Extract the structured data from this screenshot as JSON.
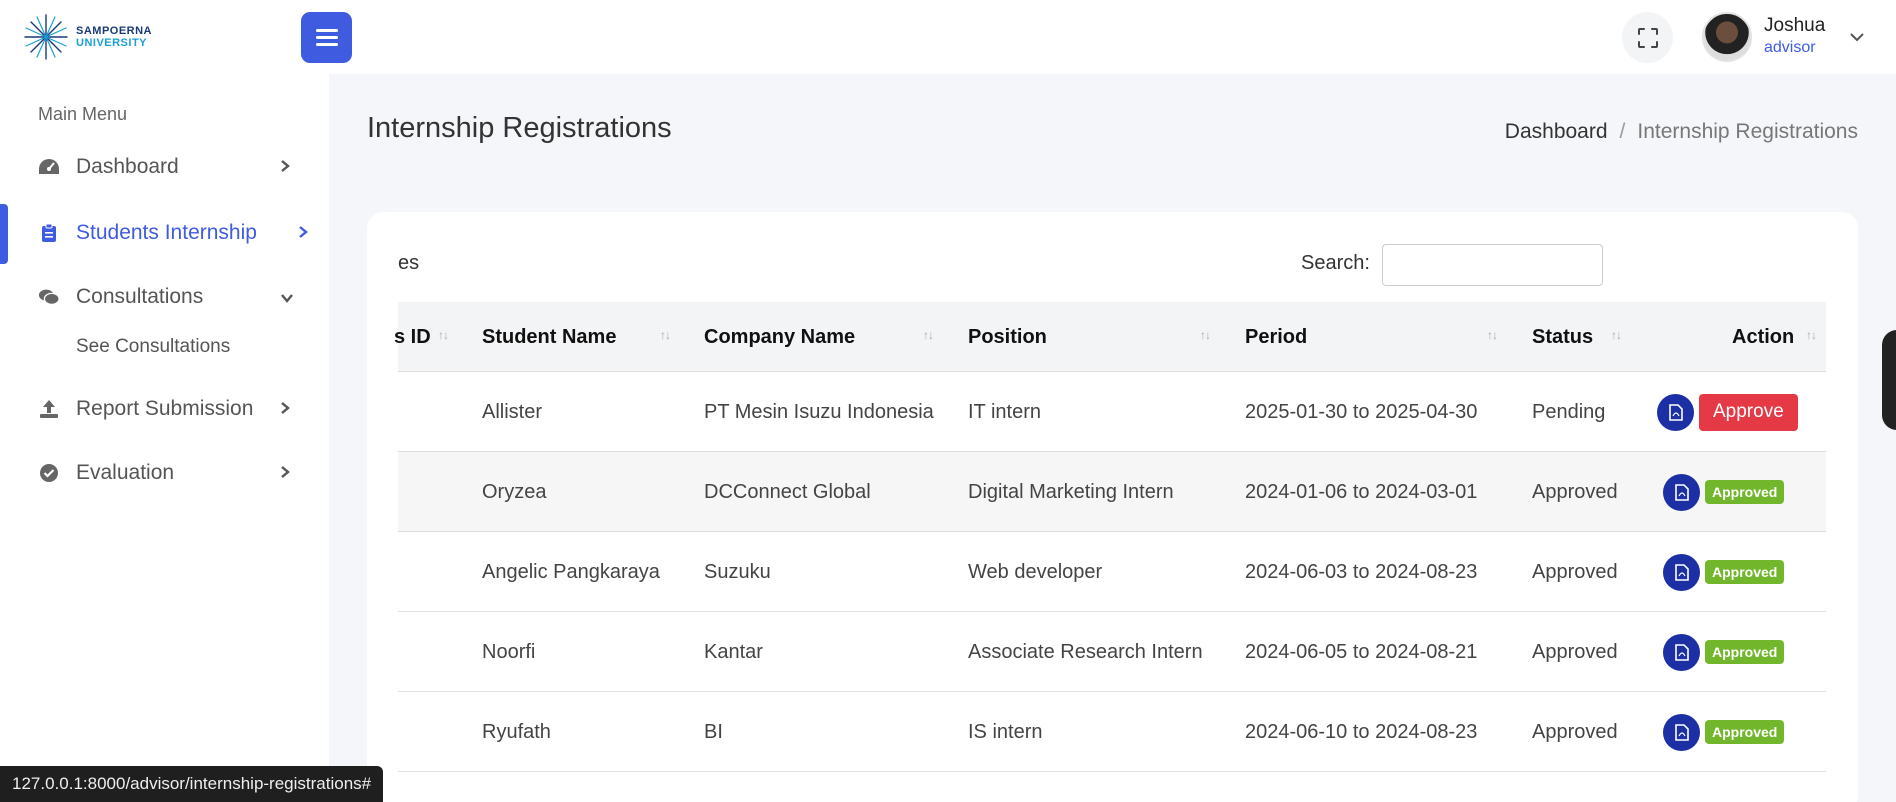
{
  "brand": {
    "line1": "SAMPOERNA",
    "line2": "UNIVERSITY"
  },
  "user": {
    "name": "Joshua",
    "role": "advisor"
  },
  "sidebar": {
    "heading": "Main Menu",
    "items": [
      {
        "label": "Dashboard",
        "icon": "speedometer-icon"
      },
      {
        "label": "Students Internship",
        "icon": "clipboard-icon"
      },
      {
        "label": "Consultations",
        "icon": "chat-icon"
      },
      {
        "label": "Report Submission",
        "icon": "upload-icon"
      },
      {
        "label": "Evaluation",
        "icon": "check-circle-icon"
      }
    ],
    "sub_item": "See Consultations"
  },
  "page": {
    "title": "Internship Registrations",
    "breadcrumb": {
      "home": "Dashboard",
      "separator": "/",
      "current": "Internship Registrations"
    }
  },
  "table": {
    "entries_fragment": "es",
    "search_label": "Search:",
    "search_value": "",
    "headers": [
      "s ID",
      "Student Name",
      "Company Name",
      "Position",
      "Period",
      "Status",
      "Action"
    ],
    "rows": [
      {
        "student": "Allister",
        "company": "PT Mesin Isuzu Indonesia",
        "position": "IT intern",
        "period": "2025-01-30 to 2025-04-30",
        "status": "Pending",
        "action": "Approve"
      },
      {
        "student": "Oryzea",
        "company": "DCConnect Global",
        "position": "Digital Marketing Intern",
        "period": "2024-01-06 to 2024-03-01",
        "status": "Approved",
        "action": "Approved"
      },
      {
        "student": "Angelic Pangkaraya",
        "company": "Suzuku",
        "position": "Web developer",
        "period": "2024-06-03 to 2024-08-23",
        "status": "Approved",
        "action": "Approved"
      },
      {
        "student": "Noorfi",
        "company": "Kantar",
        "position": "Associate Research Intern",
        "period": "2024-06-05 to 2024-08-21",
        "status": "Approved",
        "action": "Approved"
      },
      {
        "student": "Ryufath",
        "company": "BI",
        "position": "IS intern",
        "period": "2024-06-10 to 2024-08-23",
        "status": "Approved",
        "action": "Approved"
      }
    ]
  },
  "status_url": "127.0.0.1:8000/advisor/internship-registrations#",
  "colors": {
    "accent": "#3f5be0",
    "danger": "#e53946",
    "success": "#72b62c",
    "pdf": "#1c2fa4"
  }
}
